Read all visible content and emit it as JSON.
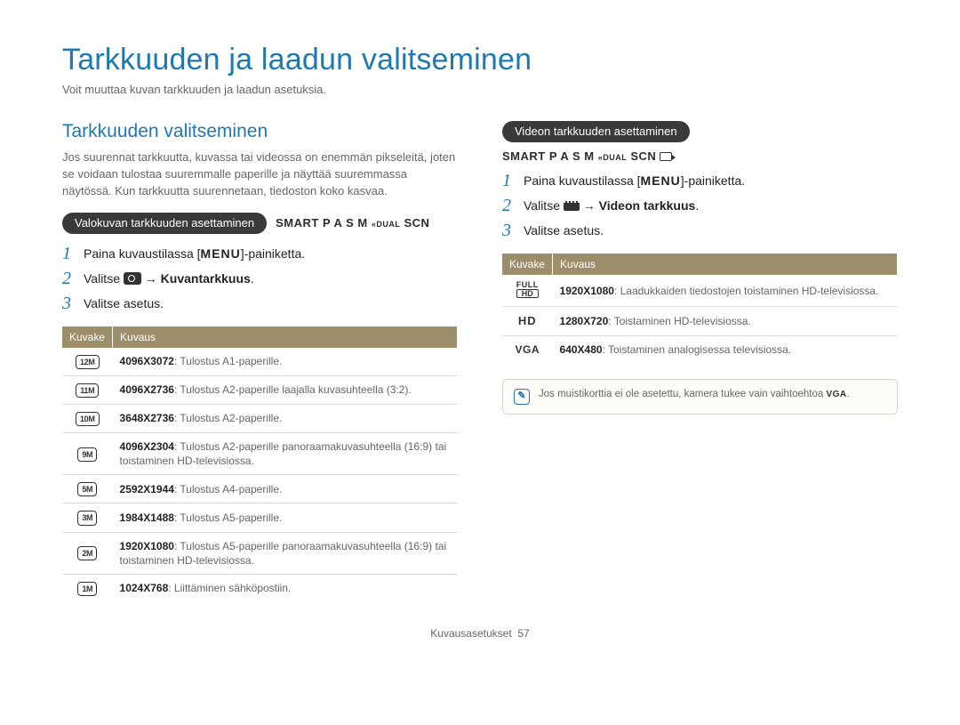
{
  "header": {
    "title": "Tarkkuuden ja laadun valitseminen",
    "intro": "Voit muuttaa kuvan tarkkuuden ja laadun asetuksia."
  },
  "left": {
    "heading": "Tarkkuuden valitseminen",
    "para": "Jos suurennat tarkkuutta, kuvassa tai videossa on enemmän pikseleitä, joten se voidaan tulostaa suuremmalle paperille ja näyttää suuremmassa näytössä. Kun tarkkuutta suurennetaan, tiedoston koko kasvaa.",
    "pill": "Valokuvan tarkkuuden asettaminen",
    "modes": [
      "SMART",
      "P",
      "A",
      "S",
      "M",
      "DUAL",
      "SCN"
    ],
    "steps": {
      "s1_a": "Paina kuvaustilassa [",
      "s1_menu": "MENU",
      "s1_b": "]-painiketta.",
      "s2_a": "Valitse ",
      "s2_b": " → ",
      "s2_c": "Kuvantarkkuus",
      "s2_d": ".",
      "s3": "Valitse asetus."
    },
    "table": {
      "col1": "Kuvake",
      "col2": "Kuvaus",
      "rows": [
        {
          "icon": "12M",
          "res": "4096X3072",
          "desc": ": Tulostus A1-paperille."
        },
        {
          "icon": "11M",
          "res": "4096X2736",
          "desc": ": Tulostus A2-paperille laajalla kuvasuhteella (3:2)."
        },
        {
          "icon": "10M",
          "res": "3648X2736",
          "desc": ": Tulostus A2-paperille."
        },
        {
          "icon": "9M",
          "res": "4096X2304",
          "desc": ": Tulostus A2-paperille panoraamakuvasuhteella (16:9) tai toistaminen HD-televisiossa."
        },
        {
          "icon": "5M",
          "res": "2592X1944",
          "desc": ": Tulostus A4-paperille."
        },
        {
          "icon": "3M",
          "res": "1984X1488",
          "desc": ": Tulostus A5-paperille."
        },
        {
          "icon": "2M",
          "res": "1920X1080",
          "desc": ": Tulostus A5-paperille panoraamakuvasuhteella (16:9) tai toistaminen HD-televisiossa."
        },
        {
          "icon": "1M",
          "res": "1024X768",
          "desc": ": Liittäminen sähköpostiin."
        }
      ]
    }
  },
  "right": {
    "pill": "Videon tarkkuuden asettaminen",
    "modes": [
      "SMART",
      "P",
      "A",
      "S",
      "M",
      "DUAL",
      "SCN"
    ],
    "steps": {
      "s1_a": "Paina kuvaustilassa [",
      "s1_menu": "MENU",
      "s1_b": "]-painiketta.",
      "s2_a": "Valitse ",
      "s2_b": " → ",
      "s2_c": "Videon tarkkuus",
      "s2_d": ".",
      "s3": "Valitse asetus."
    },
    "table": {
      "col1": "Kuvake",
      "col2": "Kuvaus",
      "rows": [
        {
          "iconKind": "fullhd",
          "res": "1920X1080",
          "desc": ": Laadukkaiden tiedostojen toistaminen HD-televisiossa."
        },
        {
          "iconKind": "hd",
          "res": "1280X720",
          "desc": ": Toistaminen HD-televisiossa."
        },
        {
          "iconKind": "vga",
          "res": "640X480",
          "desc": ": Toistaminen analogisessa televisiossa."
        }
      ]
    },
    "note_a": "Jos muistikorttia ei ole asetettu, kamera tukee vain vaihtoehtoa ",
    "note_b": "."
  },
  "footer": {
    "section": "Kuvausasetukset",
    "page": "57"
  }
}
